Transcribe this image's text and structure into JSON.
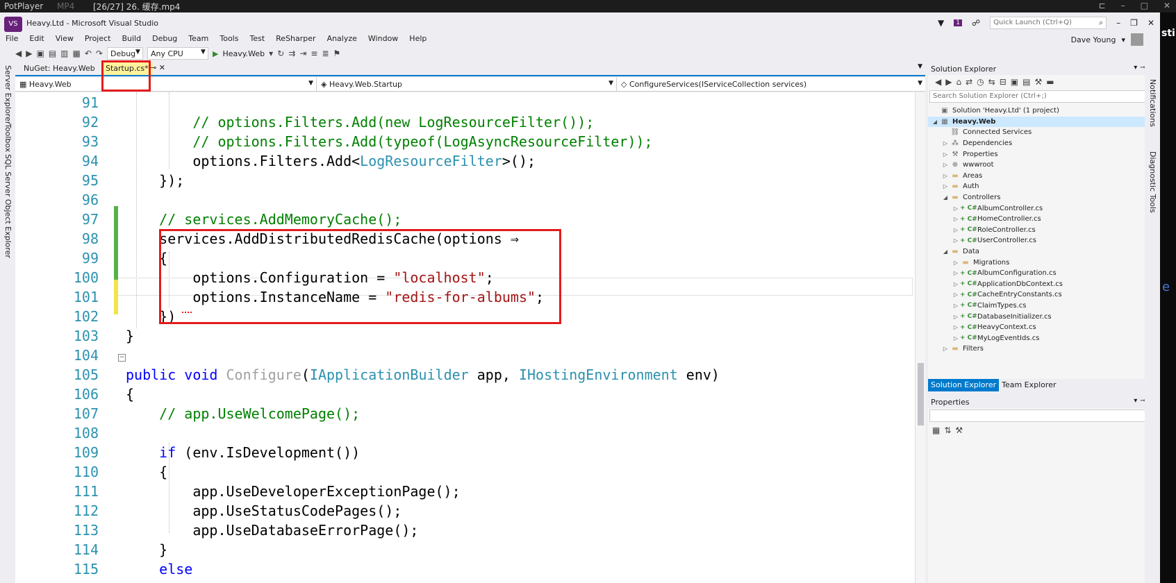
{
  "player": {
    "app_name": "PotPlayer",
    "format": "MP4",
    "file_title": "[26/27] 26. 缓存.mp4"
  },
  "window": {
    "title": "Heavy.Ltd - Microsoft Visual Studio",
    "quick_launch_placeholder": "Quick Launch (Ctrl+Q)",
    "notification_count": "1",
    "user_name": "Dave Young"
  },
  "menu": [
    "File",
    "Edit",
    "View",
    "Project",
    "Build",
    "Debug",
    "Team",
    "Tools",
    "Test",
    "ReSharper",
    "Analyze",
    "Window",
    "Help"
  ],
  "toolbar": {
    "config": "Debug",
    "platform": "Any CPU",
    "start_target": "Heavy.Web"
  },
  "left_rail": [
    "Server Explorer",
    "Toolbox",
    "SQL Server Object Explorer"
  ],
  "right_rail": [
    "Notifications",
    "Diagnostic Tools"
  ],
  "tabs": {
    "inactive": "NuGet: Heavy.Web",
    "active": "Startup.cs*"
  },
  "navbar": {
    "project": "Heavy.Web",
    "type": "Heavy.Web.Startup",
    "member": "ConfigureServices(IServiceCollection services)"
  },
  "code": [
    {
      "n": "91",
      "t": ""
    },
    {
      "n": "92",
      "t": "        // options.Filters.Add(new LogResourceFilter());"
    },
    {
      "n": "93",
      "t": "        // options.Filters.Add(typeof(LogAsyncResourceFilter));"
    },
    {
      "n": "94",
      "t": "        options.Filters.Add<LogResourceFilter>();"
    },
    {
      "n": "95",
      "t": "    });"
    },
    {
      "n": "96",
      "t": ""
    },
    {
      "n": "97",
      "t": "    // services.AddMemoryCache();"
    },
    {
      "n": "98",
      "t": "    services.AddDistributedRedisCache(options ⇒"
    },
    {
      "n": "99",
      "t": "    {"
    },
    {
      "n": "100",
      "t": "        options.Configuration = \"localhost\";"
    },
    {
      "n": "101",
      "t": "        options.InstanceName = \"redis-for-albums\";"
    },
    {
      "n": "102",
      "t": "    })"
    },
    {
      "n": "103",
      "t": "}"
    },
    {
      "n": "104",
      "t": ""
    },
    {
      "n": "105",
      "t": "public void Configure(IApplicationBuilder app, IHostingEnvironment env)"
    },
    {
      "n": "106",
      "t": "{"
    },
    {
      "n": "107",
      "t": "    // app.UseWelcomePage();"
    },
    {
      "n": "108",
      "t": ""
    },
    {
      "n": "109",
      "t": "    if (env.IsDevelopment())"
    },
    {
      "n": "110",
      "t": "    {"
    },
    {
      "n": "111",
      "t": "        app.UseDeveloperExceptionPage();"
    },
    {
      "n": "112",
      "t": "        app.UseStatusCodePages();"
    },
    {
      "n": "113",
      "t": "        app.UseDatabaseErrorPage();"
    },
    {
      "n": "114",
      "t": "    }"
    },
    {
      "n": "115",
      "t": "    else"
    }
  ],
  "solution_explorer": {
    "title": "Solution Explorer",
    "search_placeholder": "Search Solution Explorer (Ctrl+;)",
    "nodes": [
      {
        "label": "Solution 'Heavy.Ltd' (1 project)",
        "depth": 0,
        "exp": "",
        "icon": "solution-icon"
      },
      {
        "label": "Heavy.Web",
        "depth": 0,
        "exp": "◢",
        "icon": "project-icon",
        "selected": true
      },
      {
        "label": "Connected Services",
        "depth": 1,
        "exp": "",
        "icon": "connected-services-icon"
      },
      {
        "label": "Dependencies",
        "depth": 1,
        "exp": "▷",
        "icon": "dependencies-icon"
      },
      {
        "label": "Properties",
        "depth": 1,
        "exp": "▷",
        "icon": "properties-icon"
      },
      {
        "label": "wwwroot",
        "depth": 1,
        "exp": "▷",
        "icon": "globe-icon"
      },
      {
        "label": "Areas",
        "depth": 1,
        "exp": "▷",
        "icon": "folder-icon"
      },
      {
        "label": "Auth",
        "depth": 1,
        "exp": "▷",
        "icon": "folder-icon"
      },
      {
        "label": "Controllers",
        "depth": 1,
        "exp": "◢",
        "icon": "folder-icon"
      },
      {
        "label": "AlbumController.cs",
        "depth": 2,
        "exp": "▷",
        "icon": "csharp-file-icon"
      },
      {
        "label": "HomeController.cs",
        "depth": 2,
        "exp": "▷",
        "icon": "csharp-file-icon"
      },
      {
        "label": "RoleController.cs",
        "depth": 2,
        "exp": "▷",
        "icon": "csharp-file-icon"
      },
      {
        "label": "UserController.cs",
        "depth": 2,
        "exp": "▷",
        "icon": "csharp-file-icon"
      },
      {
        "label": "Data",
        "depth": 1,
        "exp": "◢",
        "icon": "folder-icon"
      },
      {
        "label": "Migrations",
        "depth": 2,
        "exp": "▷",
        "icon": "folder-icon"
      },
      {
        "label": "AlbumConfiguration.cs",
        "depth": 2,
        "exp": "▷",
        "icon": "csharp-file-icon"
      },
      {
        "label": "ApplicationDbContext.cs",
        "depth": 2,
        "exp": "▷",
        "icon": "csharp-file-icon"
      },
      {
        "label": "CacheEntryConstants.cs",
        "depth": 2,
        "exp": "▷",
        "icon": "csharp-file-icon"
      },
      {
        "label": "ClaimTypes.cs",
        "depth": 2,
        "exp": "▷",
        "icon": "csharp-file-icon"
      },
      {
        "label": "DatabaseInitializer.cs",
        "depth": 2,
        "exp": "▷",
        "icon": "csharp-file-icon"
      },
      {
        "label": "HeavyContext.cs",
        "depth": 2,
        "exp": "▷",
        "icon": "csharp-file-icon"
      },
      {
        "label": "MyLogEventIds.cs",
        "depth": 2,
        "exp": "▷",
        "icon": "csharp-file-icon"
      },
      {
        "label": "Filters",
        "depth": 1,
        "exp": "▷",
        "icon": "folder-icon"
      }
    ],
    "tab_solution": "Solution Explorer",
    "tab_team": "Team Explorer"
  },
  "properties": {
    "title": "Properties"
  },
  "colors": {
    "accent": "#007acc",
    "highlight_box": "#e31b1b",
    "comment": "#008000",
    "keyword": "#0000ff",
    "type": "#2b91af",
    "string": "#a31515"
  }
}
